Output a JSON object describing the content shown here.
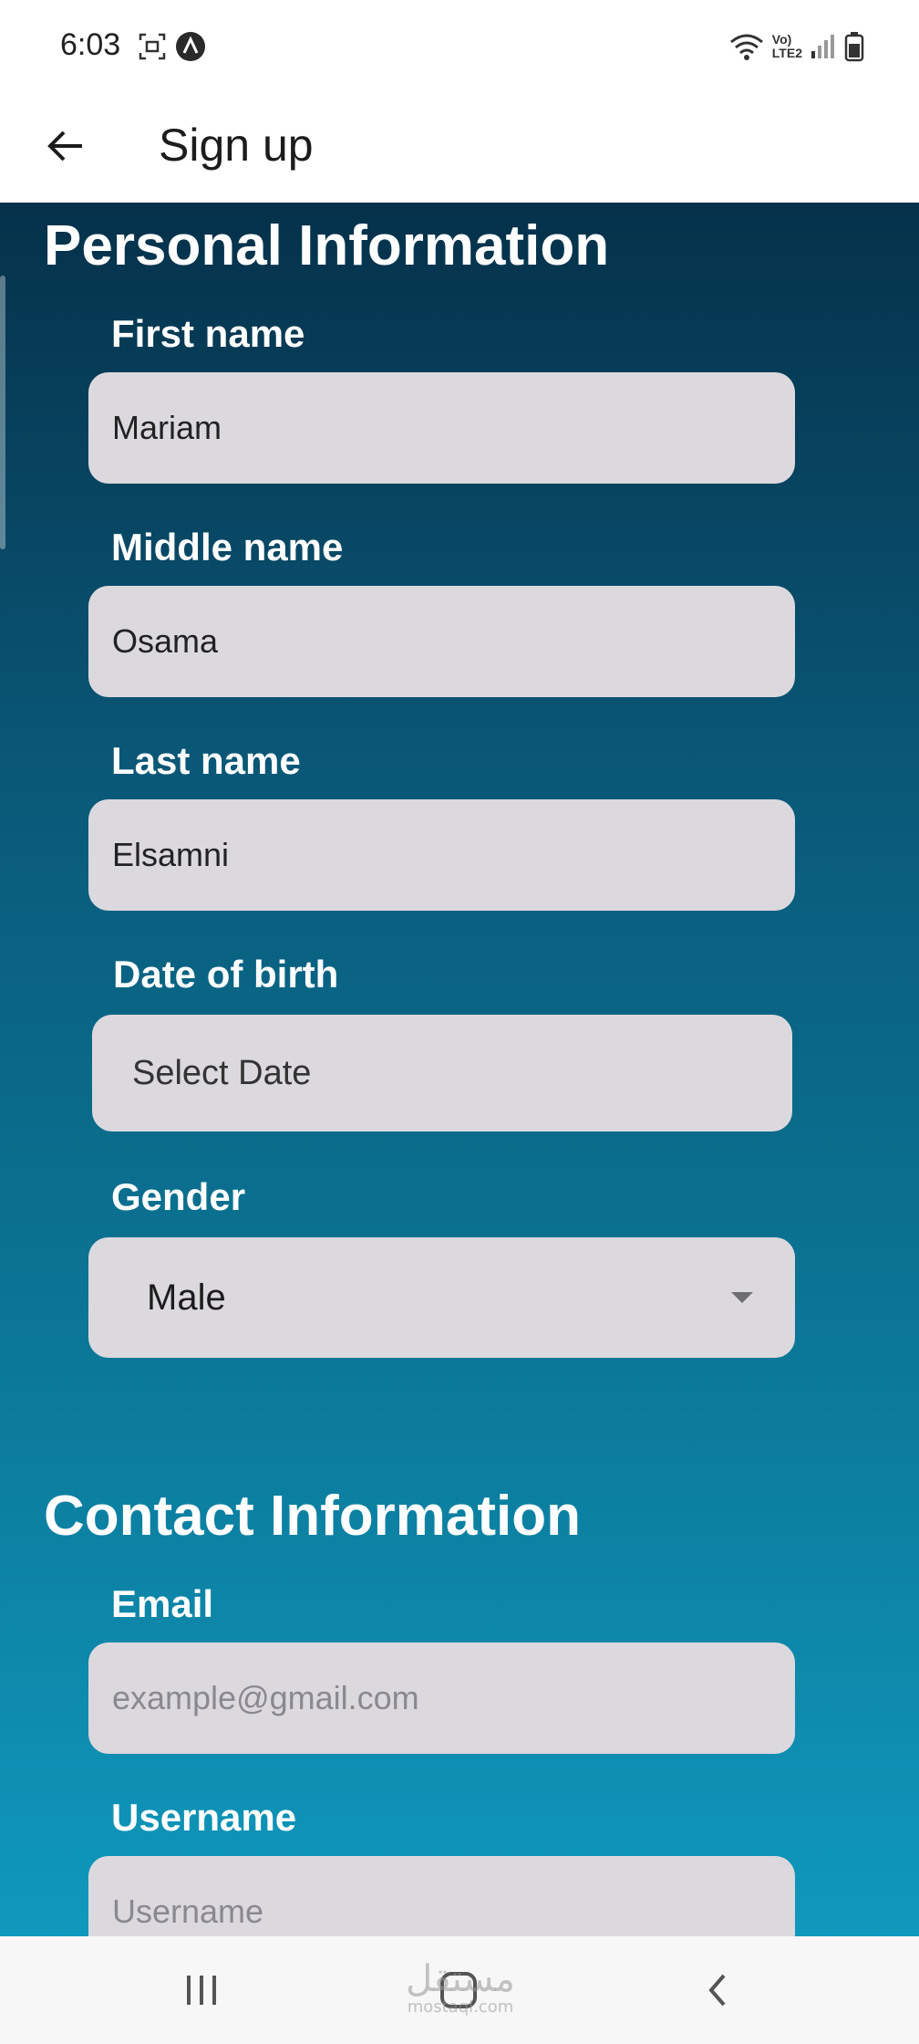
{
  "status_bar": {
    "time": "6:03",
    "volte_text": "Vo)",
    "lte_text": "LTE2"
  },
  "app_bar": {
    "title": "Sign up",
    "back_icon": "arrow-left-icon"
  },
  "personal": {
    "section_title": "Personal Information",
    "first_name": {
      "label": "First name",
      "value": "Mariam"
    },
    "middle_name": {
      "label": "Middle name",
      "value": "Osama"
    },
    "last_name": {
      "label": "Last name",
      "value": "Elsamni"
    },
    "date_of_birth": {
      "label": "Date of birth",
      "value": "Select Date"
    },
    "gender": {
      "label": "Gender",
      "value": "Male"
    }
  },
  "contact": {
    "section_title": "Contact Information",
    "email": {
      "label": "Email",
      "placeholder": "example@gmail.com"
    },
    "username": {
      "label": "Username",
      "placeholder": "Username"
    }
  },
  "watermark": {
    "main": "مستقل",
    "sub": "mostaql.com"
  },
  "colors": {
    "gradient_top": "#05314a",
    "gradient_bottom": "#0f98bd",
    "field_bg": "#dcd9de",
    "label_text": "#ffffff"
  }
}
